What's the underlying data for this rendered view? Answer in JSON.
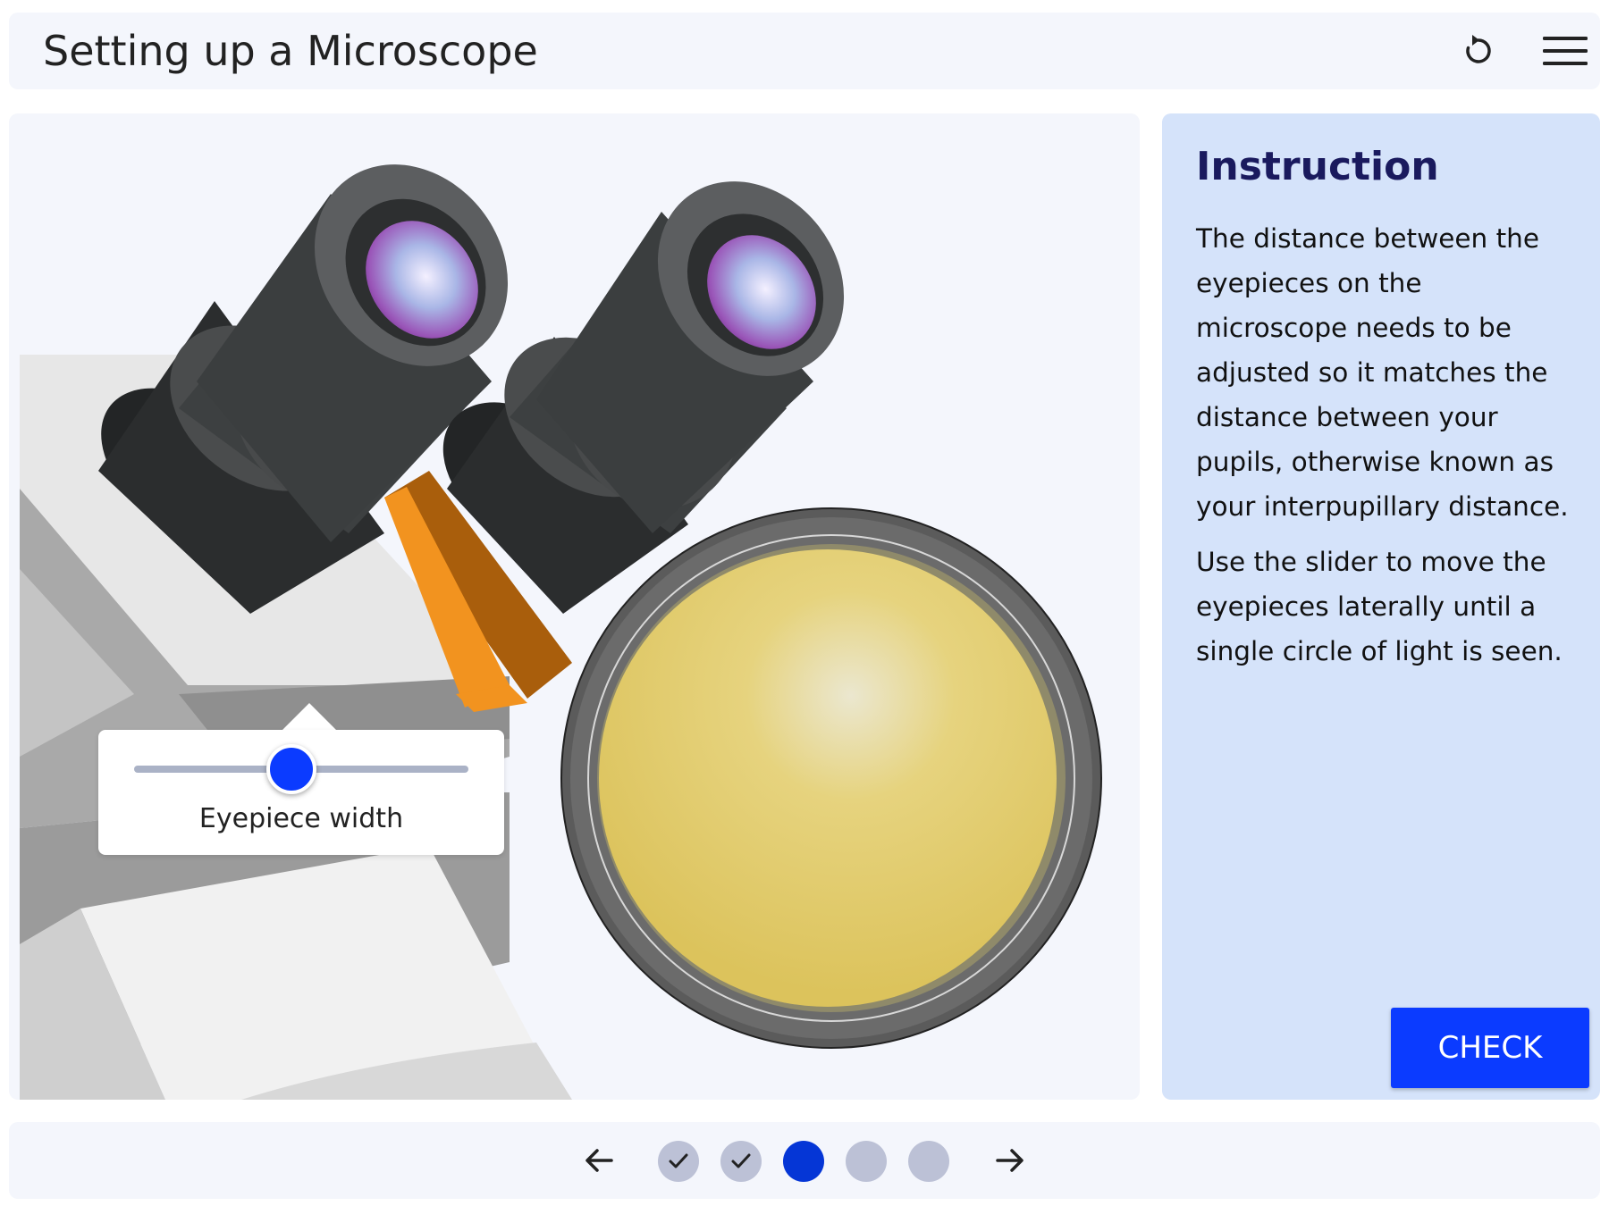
{
  "header": {
    "title": "Setting up a Microscope",
    "reset_icon": "reset-icon",
    "menu_icon": "hamburger-menu-icon"
  },
  "scene": {
    "slider": {
      "label": "Eyepiece width",
      "value_fraction": 0.47
    }
  },
  "instruction": {
    "heading": "Instruction",
    "paragraphs": [
      "The distance between the eyepieces on the microscope needs to be adjusted so it matches the distance between your pupils, otherwise known as your interpupillary distance.",
      "Use the slider to move the eyepieces laterally until a single circle of light is seen."
    ],
    "check_label": "CHECK"
  },
  "footer": {
    "prev_icon": "arrow-left-icon",
    "next_icon": "arrow-right-icon",
    "steps": [
      {
        "state": "completed"
      },
      {
        "state": "completed"
      },
      {
        "state": "current"
      },
      {
        "state": "upcoming"
      },
      {
        "state": "upcoming"
      }
    ]
  },
  "colors": {
    "accent": "#0b3bff",
    "current_step": "#0536d6",
    "panel": "#d5e3fa",
    "heading": "#1a1a5e"
  }
}
